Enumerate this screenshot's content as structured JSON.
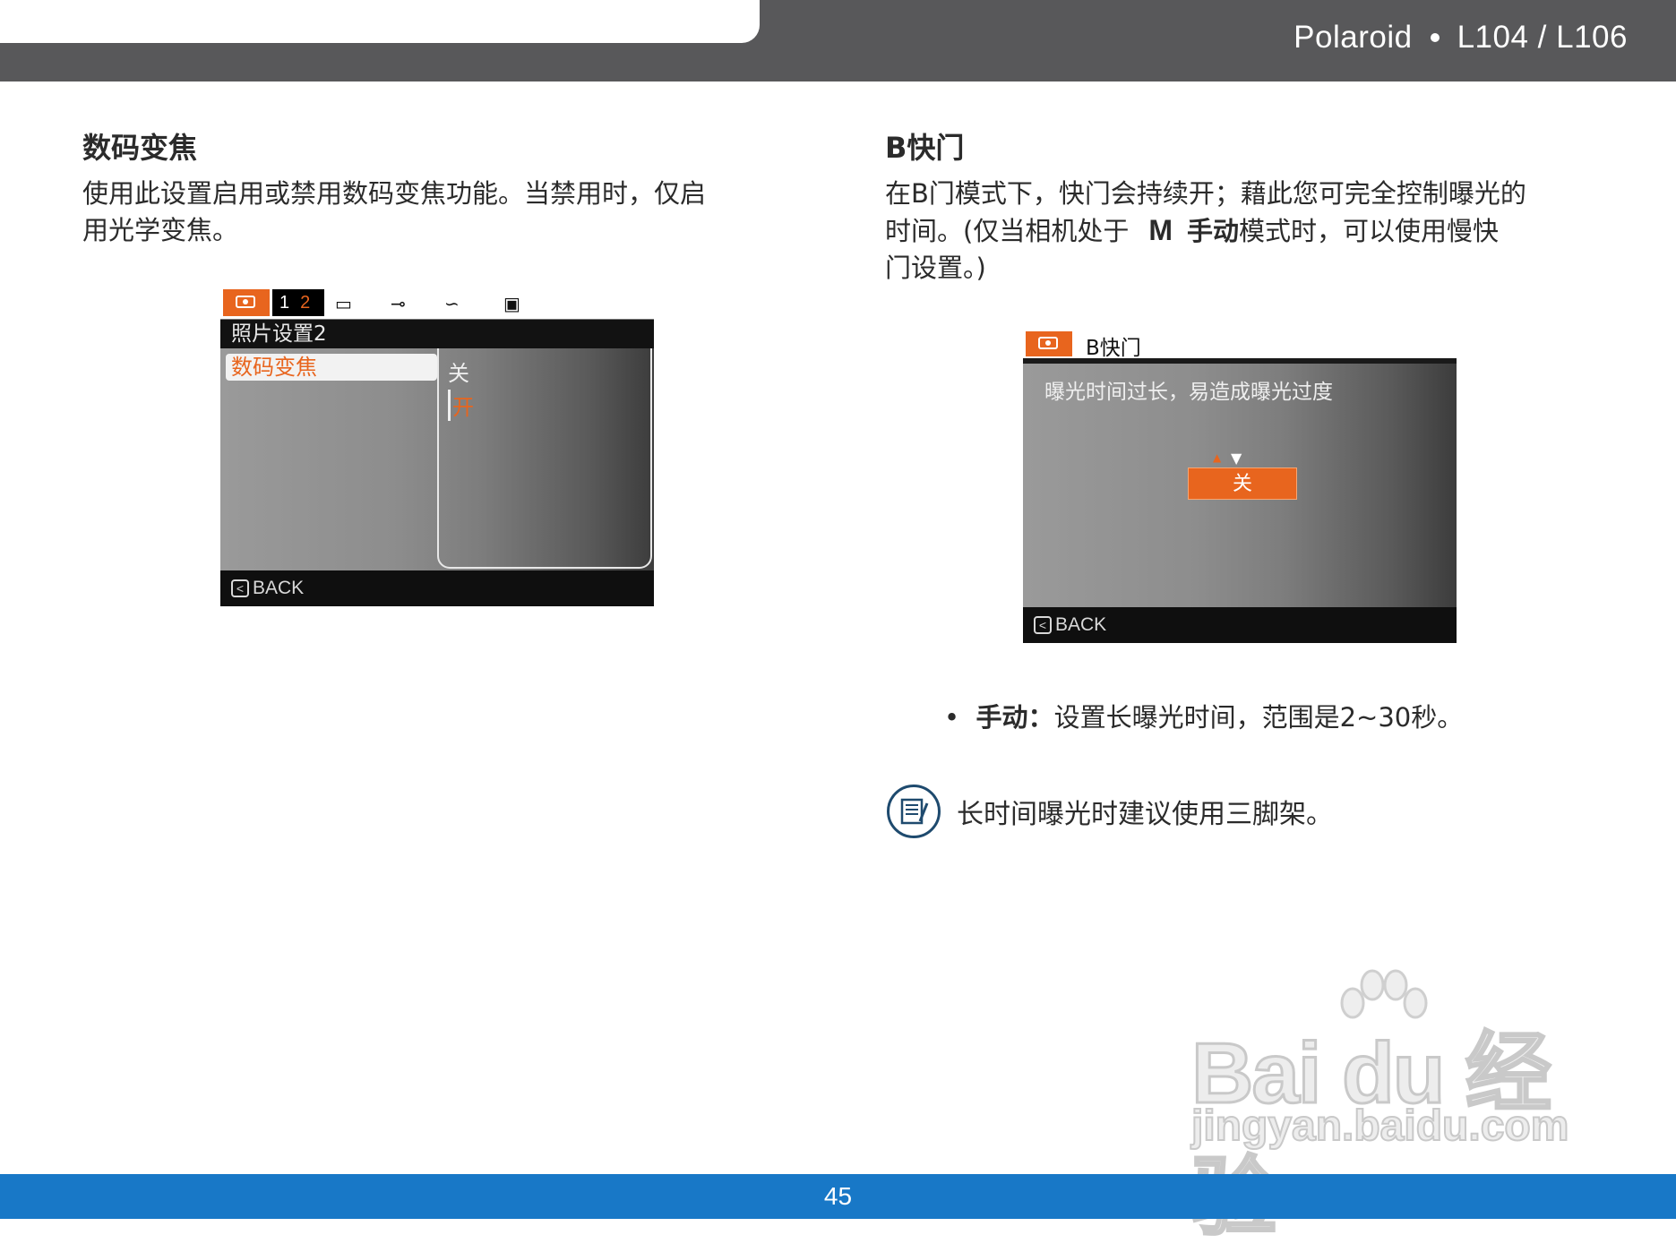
{
  "header": {
    "brand": "Polaroid",
    "model": "L104 / L106"
  },
  "left": {
    "heading": "数码变焦",
    "body": [
      "使用此设置启用或禁用数码变焦功能。当禁用时，仅启",
      "用光学变焦。"
    ],
    "screen": {
      "page_num_1": "1",
      "page_num_2": "2",
      "subtitle": "照片设置2",
      "menu_item": "数码变焦",
      "option_off": "关",
      "option_on": "开",
      "back": "BACK"
    }
  },
  "right": {
    "heading": "B快门",
    "body_line1": "在B门模式下，快门会持续开；藉此您可完全控制曝光的",
    "body_line2_pre": "时间。(仅当相机处于",
    "body_mode_glyph": "M",
    "body_line2_bold": "手动",
    "body_line2_post": "模式时，可以使用慢快",
    "body_line3": "门设置。)",
    "screen": {
      "title": "B快门",
      "message": "曝光时间过长，易造成曝光过度",
      "value": "关",
      "back": "BACK"
    },
    "bullet_label": "手动：",
    "bullet_text": "设置长曝光时间，范围是2~30秒。",
    "note": "长时间曝光时建议使用三脚架。"
  },
  "watermark": {
    "main": "Bai du 经验",
    "url": "jingyan.baidu.com"
  },
  "footer": {
    "page_number": "45"
  },
  "colors": {
    "accent_orange": "#e8651e",
    "footer_blue": "#1878c7",
    "header_gray": "#58585a"
  }
}
